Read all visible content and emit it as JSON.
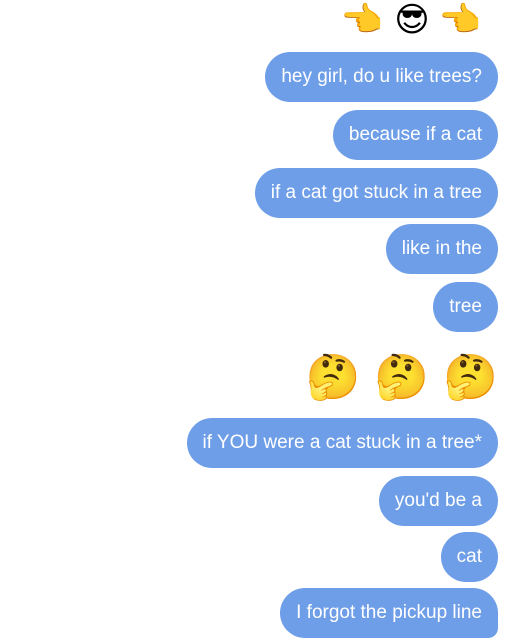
{
  "emoji_top": [
    "👉",
    "😎",
    "👉"
  ],
  "emoji_thinking": [
    "🤔",
    "🤔",
    "🤔"
  ],
  "messages": [
    "hey girl, do u like trees?",
    "because if a cat",
    "if a cat got stuck in a tree",
    "like in the",
    "tree",
    "if YOU were a cat stuck in a tree*",
    "you'd be a",
    "cat",
    "I forgot the pickup line"
  ],
  "colors": {
    "bubble_background": "#6e9ee8",
    "bubble_text": "#ffffff",
    "page_background": "#ffffff"
  }
}
